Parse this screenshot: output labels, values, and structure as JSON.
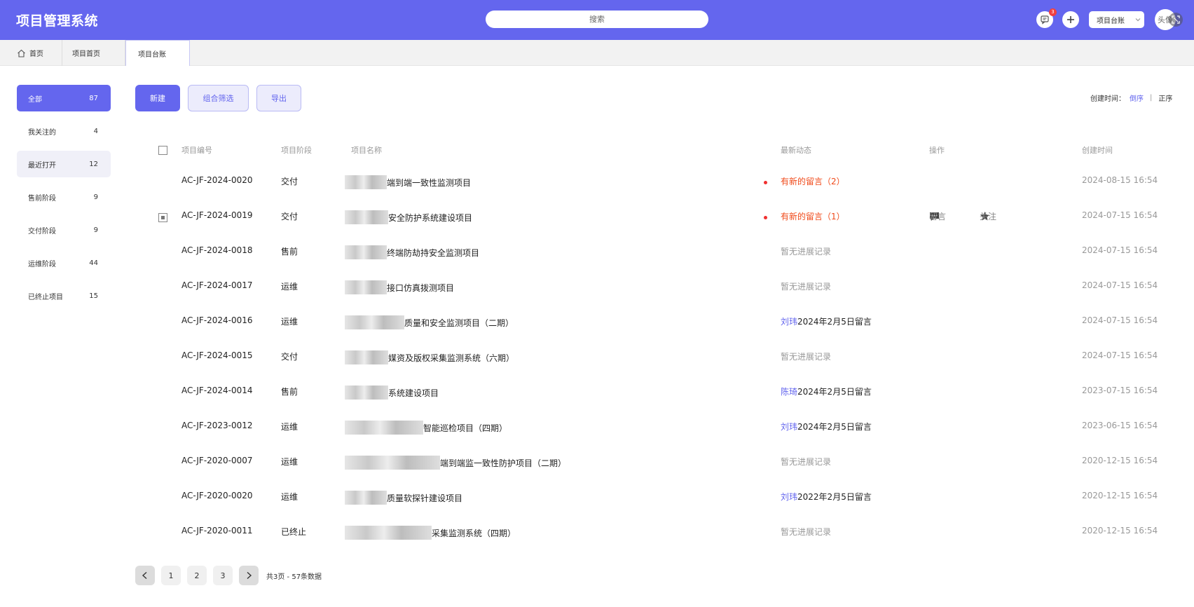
{
  "header": {
    "app_title": "项目管理系统",
    "search_placeholder": "搜索",
    "message_badge": "3",
    "ledger_select": "项目台账",
    "avatar_text": "头像"
  },
  "tabs": [
    {
      "label": "首页"
    },
    {
      "label": "项目首页"
    },
    {
      "label": "项目台账"
    }
  ],
  "sidebar": {
    "items": [
      {
        "label": "全部",
        "count": "87"
      },
      {
        "label": "我关注的",
        "count": "4"
      },
      {
        "label": "最近打开",
        "count": "12"
      },
      {
        "label": "售前阶段",
        "count": "9"
      },
      {
        "label": "交付阶段",
        "count": "9"
      },
      {
        "label": "运维阶段",
        "count": "44"
      },
      {
        "label": "已终止项目",
        "count": "15"
      }
    ]
  },
  "toolbar": {
    "new_label": "新建",
    "filter_label": "组合筛选",
    "export_label": "导出",
    "sort_label": "创建时间：",
    "sort_desc": "倒序",
    "sort_sep": "|",
    "sort_asc": "正序"
  },
  "table": {
    "headers": {
      "code": "项目编号",
      "stage": "项目阶段",
      "name": "项目名称",
      "dynamic": "最新动态",
      "ops": "操作",
      "created": "创建时间"
    },
    "ops": {
      "comment": "留言",
      "follow": "关注"
    },
    "rows": [
      {
        "code": "AC-JF-2024-0020",
        "stage": "交付",
        "name": "端到端一致性监测项目",
        "dyn_user": "",
        "dynamic": "有新的留言（2）",
        "created": "2024-08-15   16:54"
      },
      {
        "code": "AC-JF-2024-0019",
        "stage": "交付",
        "name": "安全防护系统建设项目",
        "dyn_user": "",
        "dynamic": "有新的留言（1）",
        "created": "2024-07-15   16:54"
      },
      {
        "code": "AC-JF-2024-0018",
        "stage": "售前",
        "name": "终端防劫持安全监测项目",
        "dyn_user": "",
        "dynamic": "暂无进展记录",
        "created": "2024-07-15   16:54"
      },
      {
        "code": "AC-JF-2024-0017",
        "stage": "运维",
        "name": "接口仿真拨测项目",
        "dyn_user": "",
        "dynamic": "暂无进展记录",
        "created": "2024-07-15   16:54"
      },
      {
        "code": "AC-JF-2024-0016",
        "stage": "运维",
        "name": "质量和安全监测项目（二期）",
        "dyn_user": "刘玮",
        "dynamic": "2024年2月5日留言",
        "created": "2024-07-15   16:54"
      },
      {
        "code": "AC-JF-2024-0015",
        "stage": "交付",
        "name": "媒资及版权采集监测系统（六期）",
        "dyn_user": "",
        "dynamic": "暂无进展记录",
        "created": "2024-07-15   16:54"
      },
      {
        "code": "AC-JF-2024-0014",
        "stage": "售前",
        "name": "系统建设项目",
        "dyn_user": "陈琦",
        "dynamic": "2024年2月5日留言",
        "created": "2023-07-15   16:54"
      },
      {
        "code": "AC-JF-2023-0012",
        "stage": "运维",
        "name": "智能巡检项目（四期）",
        "dyn_user": "刘玮",
        "dynamic": "2024年2月5日留言",
        "created": "2023-06-15   16:54"
      },
      {
        "code": "AC-JF-2020-0007",
        "stage": "运维",
        "name": "端到端监一致性防护项目（二期）",
        "dyn_user": "",
        "dynamic": "暂无进展记录",
        "created": "2020-12-15   16:54"
      },
      {
        "code": "AC-JF-2020-0020",
        "stage": "运维",
        "name": "质量软探针建设项目",
        "dyn_user": "刘玮",
        "dynamic": "2022年2月5日留言",
        "created": "2020-12-15   16:54"
      },
      {
        "code": "AC-JF-2020-0011",
        "stage": "已终止",
        "name": "采集监测系统（四期）",
        "dyn_user": "",
        "dynamic": "暂无进展记录",
        "created": "2020-12-15   16:54"
      }
    ]
  },
  "pagination": {
    "pages": [
      "1",
      "2",
      "3"
    ],
    "info": "共3页 - 57条数据"
  },
  "colors": {
    "primary": "#6466ee",
    "alert": "#f04a1a"
  }
}
